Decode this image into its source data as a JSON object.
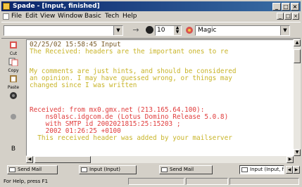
{
  "window": {
    "title": "Spade - [Input, finished]",
    "controls": [
      "_",
      "□",
      "×"
    ]
  },
  "menu": {
    "items": [
      "File",
      "Edit",
      "View",
      "Window",
      "Basic",
      "Tech",
      "Help"
    ],
    "mdi_controls": [
      "_",
      "□",
      "×"
    ]
  },
  "toolbar": {
    "font_size": "10",
    "magic": "Magic"
  },
  "tools": [
    {
      "label": "Cut",
      "icon": "cut-icon"
    },
    {
      "label": "Copy",
      "icon": "copy-icon"
    },
    {
      "label": "Paste",
      "icon": "paste-icon"
    },
    {
      "label": "",
      "icon": "circle-icon"
    },
    {
      "label": "",
      "icon": "tool-icon"
    }
  ],
  "editor": {
    "lines": [
      {
        "text": "02/25/02 15:58:45 Input",
        "color": "#7a5c2a"
      },
      {
        "text": "The Received: headers are the important ones to re",
        "color": "#c8b428"
      },
      {
        "text": "",
        "color": "#000000"
      },
      {
        "text": "My comments are just hints, and should be considered",
        "color": "#c8b428"
      },
      {
        "text": "an opinion. I may have guessed wrong, or things may",
        "color": "#c8b428"
      },
      {
        "text": "changed since I was written",
        "color": "#c8b428"
      },
      {
        "text": "",
        "color": "#000000"
      },
      {
        "text": "Received: from mx0.gmx.net (213.165.64.100):",
        "color": "#e03c3c"
      },
      {
        "text": "    ns0lasc.idgcom.de (Lotus Domino Release 5.0.8)",
        "color": "#e03c3c"
      },
      {
        "text": "    with SMTP id 2002021815:25:15203 ;",
        "color": "#e03c3c"
      },
      {
        "text": "    2002 01:26:25 +0100",
        "color": "#e03c3c"
      },
      {
        "text": "  This received header was added by your mailserver",
        "color": "#c8b428"
      }
    ]
  },
  "tasks": [
    {
      "label": "Send Mail"
    },
    {
      "label": "Input (Input)"
    },
    {
      "label": "Send Mail"
    },
    {
      "label": "Input (Input, finished)"
    }
  ],
  "status": {
    "text": "For Help, press F1"
  }
}
